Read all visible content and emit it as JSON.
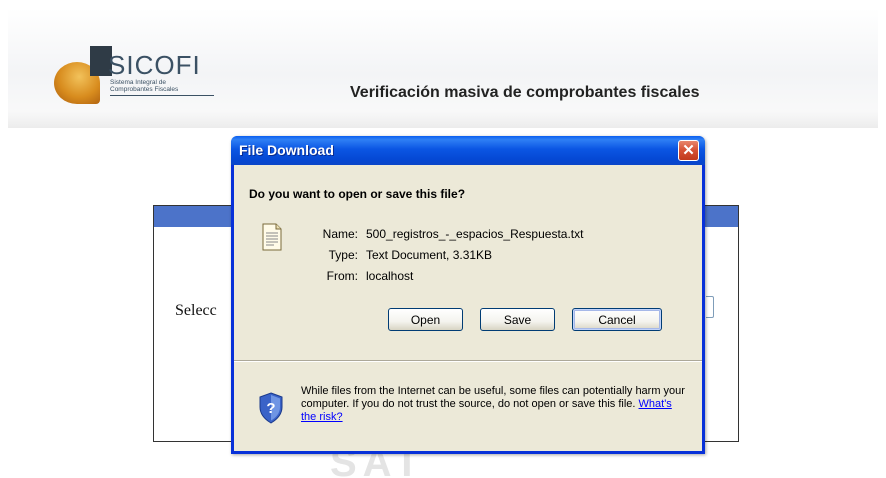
{
  "page": {
    "logo_text": "SICOFI",
    "logo_subtitle_line1": "Sistema Integral de",
    "logo_subtitle_line2": "Comprobantes Fiscales",
    "title": "Verificación masiva de comprobantes fiscales",
    "panel_label": "Selecc",
    "watermark": "SAT",
    "colors": {
      "panel_bar": "#4c73c9"
    }
  },
  "dialog": {
    "title": "File Download",
    "question": "Do you want to open or save this file?",
    "fields": [
      {
        "label": "Name:",
        "value": "500_registros_-_espacios_Respuesta.txt"
      },
      {
        "label": "Type:",
        "value": "Text Document, 3.31KB"
      },
      {
        "label": "From:",
        "value": "localhost"
      }
    ],
    "buttons": {
      "open": "Open",
      "save": "Save",
      "cancel": "Cancel"
    },
    "warning_text": "While files from the Internet can be useful, some files can potentially harm your computer. If you do not trust the source, do not open or save this file.",
    "warning_link": "What's the risk?",
    "icons": {
      "file": "text-file-icon",
      "shield": "shield-question-icon",
      "close": "close-icon"
    },
    "colors": {
      "titlebar": "#0b56e3",
      "client_bg": "#ece9d8",
      "close_button": "#d55033",
      "link": "#0000ff"
    }
  }
}
